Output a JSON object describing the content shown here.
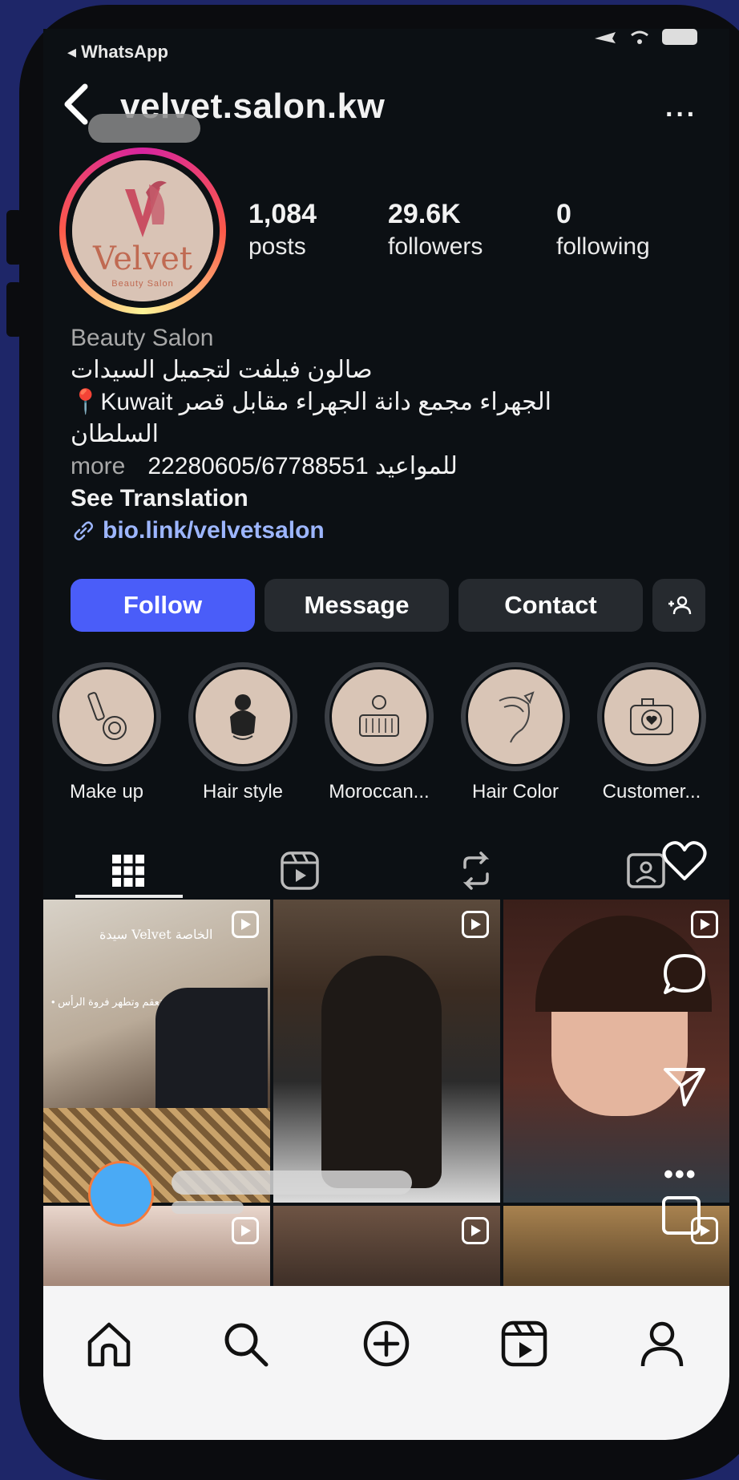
{
  "status_bar": {
    "back_app": "◂ WhatsApp"
  },
  "header": {
    "username": "velvet.salon.kw",
    "more": "···"
  },
  "profile": {
    "avatar_text": "Velvet",
    "avatar_subtext": "Beauty Salon",
    "stats": [
      {
        "value": "1,084",
        "label": "posts"
      },
      {
        "value": "29.6K",
        "label": "followers"
      },
      {
        "value": "0",
        "label": "following"
      }
    ]
  },
  "bio": {
    "category": "Beauty Salon",
    "line1": "صالون فيلفت لتجميل السيدات",
    "line2": "📍Kuwait الجهراء مجمع دانة الجهراء مقابل قصر",
    "line3": "السلطان",
    "more": "more",
    "line4": "للمواعيد 22280605/67788551",
    "see_translation": "See Translation",
    "link": "bio.link/velvetsalon"
  },
  "actions": {
    "follow": "Follow",
    "message": "Message",
    "contact": "Contact"
  },
  "highlights": [
    {
      "label": "Make up"
    },
    {
      "label": "Hair style"
    },
    {
      "label": "Moroccan..."
    },
    {
      "label": "Hair Color"
    },
    {
      "label": "Customer..."
    }
  ],
  "grid": {
    "cell1_caption_a": "سيدة Velvet الخاصة",
    "cell1_caption_b": "• تنظف وتعقم وتطهر فروة الرأس"
  },
  "colors": {
    "follow": "#4a5df9",
    "link": "#9db6ff",
    "frame": "#1e2668"
  }
}
